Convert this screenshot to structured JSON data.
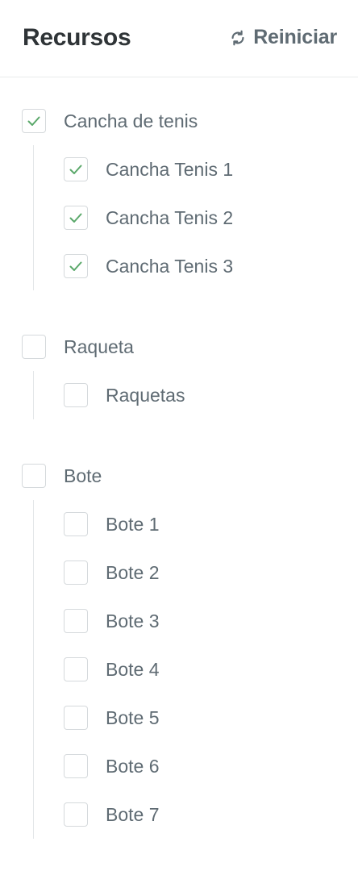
{
  "header": {
    "title": "Recursos",
    "reset_label": "Reiniciar"
  },
  "colors": {
    "check": "#5aa86a",
    "accent_text": "#5f6b73"
  },
  "groups": [
    {
      "label": "Cancha de tenis",
      "checked": true,
      "items": [
        {
          "label": "Cancha Tenis 1",
          "checked": true
        },
        {
          "label": "Cancha Tenis 2",
          "checked": true
        },
        {
          "label": "Cancha Tenis 3",
          "checked": true
        }
      ]
    },
    {
      "label": "Raqueta",
      "checked": false,
      "items": [
        {
          "label": "Raquetas",
          "checked": false
        }
      ]
    },
    {
      "label": "Bote",
      "checked": false,
      "items": [
        {
          "label": "Bote 1",
          "checked": false
        },
        {
          "label": "Bote 2",
          "checked": false
        },
        {
          "label": "Bote 3",
          "checked": false
        },
        {
          "label": "Bote 4",
          "checked": false
        },
        {
          "label": "Bote 5",
          "checked": false
        },
        {
          "label": "Bote 6",
          "checked": false
        },
        {
          "label": "Bote 7",
          "checked": false
        }
      ]
    }
  ]
}
